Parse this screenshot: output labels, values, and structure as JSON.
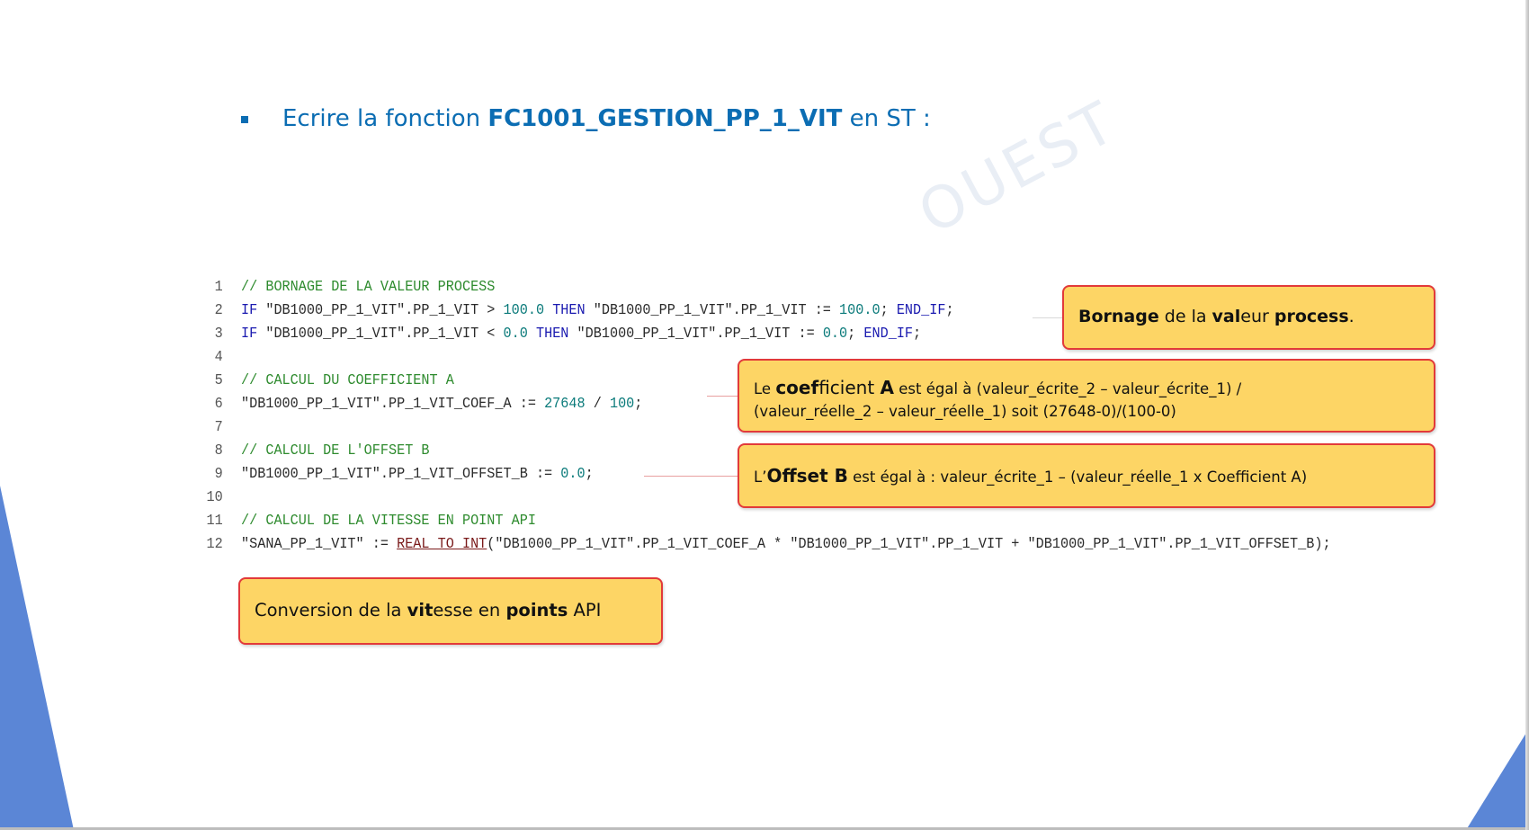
{
  "colors": {
    "heading_blue": "#0b6db3",
    "deco_blue": "#5b86d6",
    "callout_fill": "#fdd565",
    "callout_border": "#e23a3a",
    "code_comment": "#2e8b2e",
    "code_keyword": "#1a1ab0",
    "code_number": "#0a7a7a"
  },
  "heading": {
    "bullet_icon": "square-bullet-icon",
    "prefix": "Ecrire la fonction",
    "function_name": "FC1001_GESTION_PP_1_VIT",
    "suffix": "en ST :"
  },
  "watermark": {
    "text": "OUEST"
  },
  "code": {
    "lines": [
      {
        "number": "1",
        "comment": "// BORNAGE DE LA VALEUR PROCESS"
      },
      {
        "number": "2",
        "kw_if": "IF",
        "cond": " \"DB1000_PP_1_VIT\".PP_1_VIT > ",
        "limit": "100.0",
        "kw_then": "THEN",
        "assign": " \"DB1000_PP_1_VIT\".PP_1_VIT := ",
        "value": "100.0",
        "semi": "; ",
        "kw_endif": "END_IF",
        "end": ";"
      },
      {
        "number": "3",
        "kw_if": "IF",
        "cond": " \"DB1000_PP_1_VIT\".PP_1_VIT < ",
        "limit": "0.0",
        "kw_then": "THEN",
        "assign": " \"DB1000_PP_1_VIT\".PP_1_VIT := ",
        "value": "0.0",
        "semi": "; ",
        "kw_endif": "END_IF",
        "end": ";"
      },
      {
        "number": "4"
      },
      {
        "number": "5",
        "comment": "// CALCUL DU COEFFICIENT A"
      },
      {
        "number": "6",
        "target": "\"DB1000_PP_1_VIT\".PP_1_VIT_COEF_A := ",
        "num1": "27648",
        "op": " / ",
        "num2": "100",
        "end": ";"
      },
      {
        "number": "7"
      },
      {
        "number": "8",
        "comment": "// CALCUL DE L'OFFSET B"
      },
      {
        "number": "9",
        "target": "\"DB1000_PP_1_VIT\".PP_1_VIT_OFFSET_B := ",
        "value": "0.0",
        "end": ";"
      },
      {
        "number": "10"
      },
      {
        "number": "11",
        "comment": "// CALCUL DE LA VITESSE EN POINT API"
      },
      {
        "number": "12",
        "target": "\"SANA_PP_1_VIT\" := ",
        "func": "REAL_TO_INT",
        "args": "(\"DB1000_PP_1_VIT\".PP_1_VIT_COEF_A * \"DB1000_PP_1_VIT\".PP_1_VIT + \"DB1000_PP_1_VIT\".PP_1_VIT_OFFSET_B);"
      }
    ]
  },
  "callouts": {
    "bornage": {
      "w1": "Bornage",
      "t1": " de la ",
      "w2": "val",
      "t2": "eur ",
      "w3": "process",
      "t3": "."
    },
    "coefficient": {
      "t1": "Le ",
      "w1": "coef",
      "t2": "ficient ",
      "w2": "A",
      "t3": " est égal à (valeur_écrite_2 – valeur_écrite_1) /",
      "line2": "(valeur_réelle_2 – valeur_réelle_1) soit (27648-0)/(100-0)"
    },
    "offset": {
      "t1": "L’",
      "w1": "Offset B",
      "t2": " est égal à : valeur_écrite_1 – (valeur_réelle_1 x Coefficient A)"
    },
    "conversion": {
      "t1": "Conversion de la ",
      "w1": "vit",
      "t2": "esse en ",
      "w2": "points",
      "t3": " API"
    }
  }
}
